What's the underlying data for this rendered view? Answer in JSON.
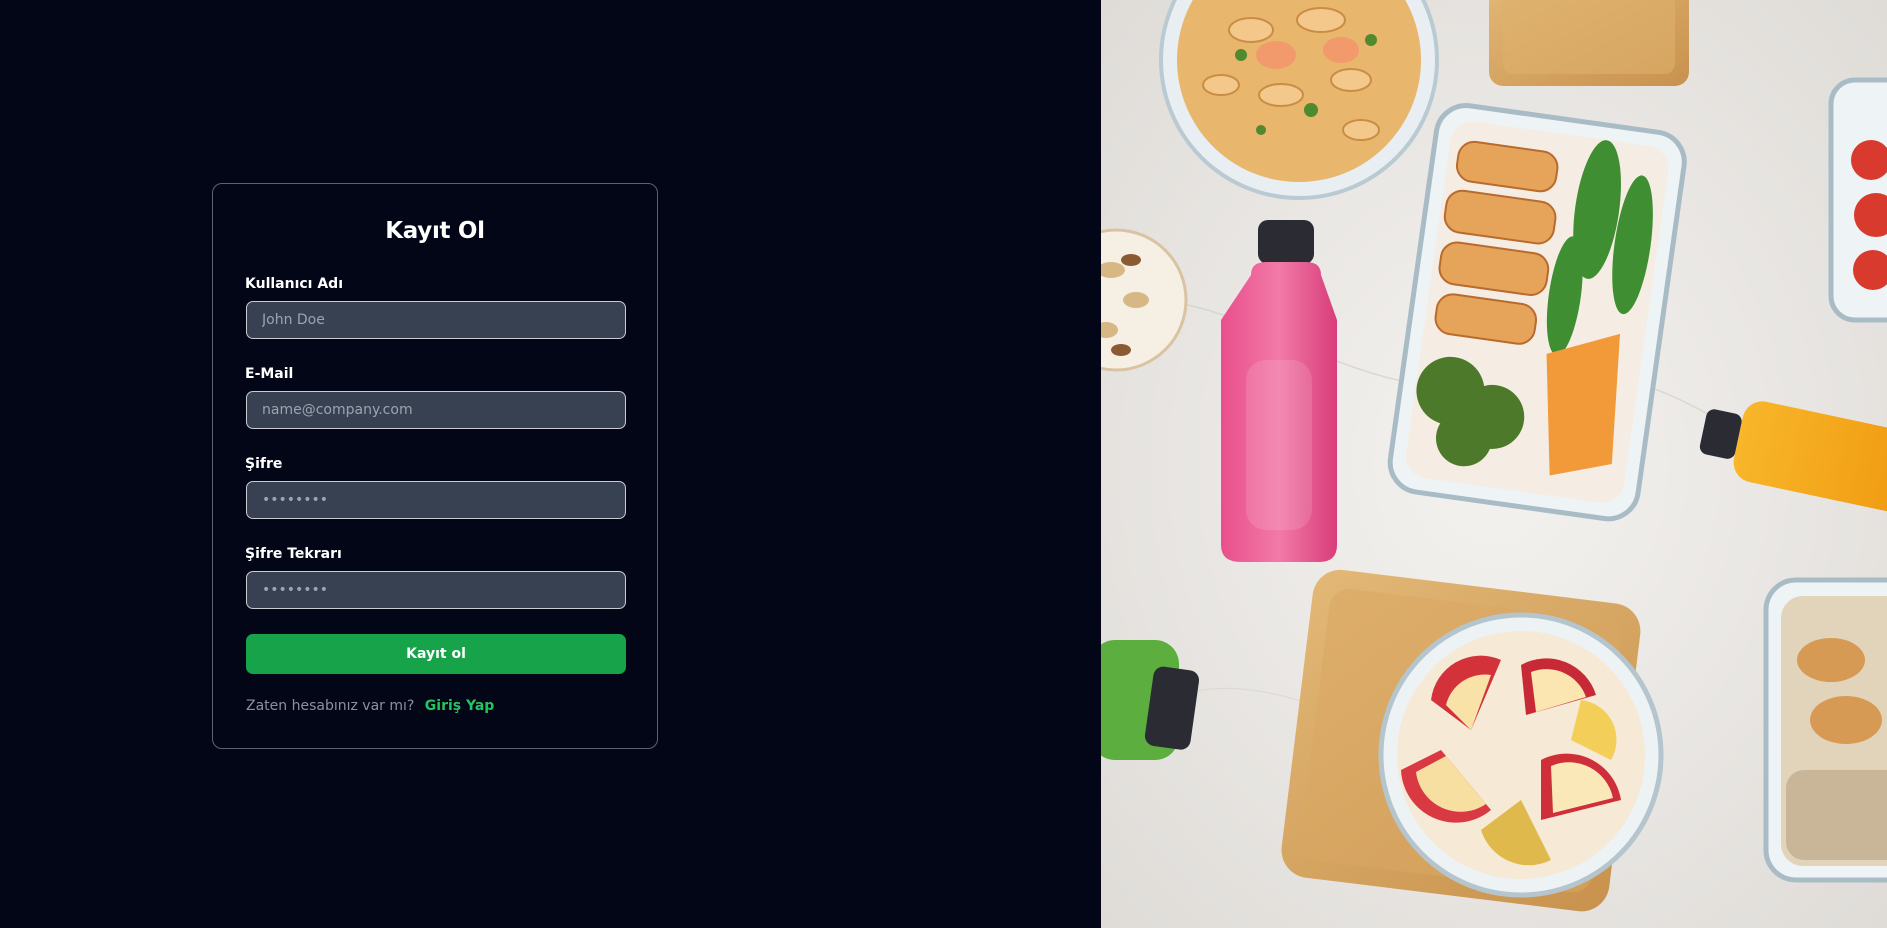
{
  "form": {
    "title": "Kayıt Ol",
    "username": {
      "label": "Kullanıcı Adı",
      "placeholder": "John Doe"
    },
    "email": {
      "label": "E-Mail",
      "placeholder": "name@company.com"
    },
    "password": {
      "label": "Şifre",
      "placeholder": "••••••••"
    },
    "password_repeat": {
      "label": "Şifre Tekrarı",
      "placeholder": "••••••••"
    },
    "submit_label": "Kayıt ol",
    "login_question": "Zaten hesabınız var mı?",
    "login_link": "Giriş Yap"
  },
  "colors": {
    "background": "#030617",
    "input_background": "#374151",
    "accent_green": "#16a34a",
    "link_green": "#22c55e"
  },
  "photo": {
    "alt": "Healthy meal prep: pasta salad, chicken with broccoli and sweet potato, pink and orange juices, sliced apples on bamboo tray"
  }
}
